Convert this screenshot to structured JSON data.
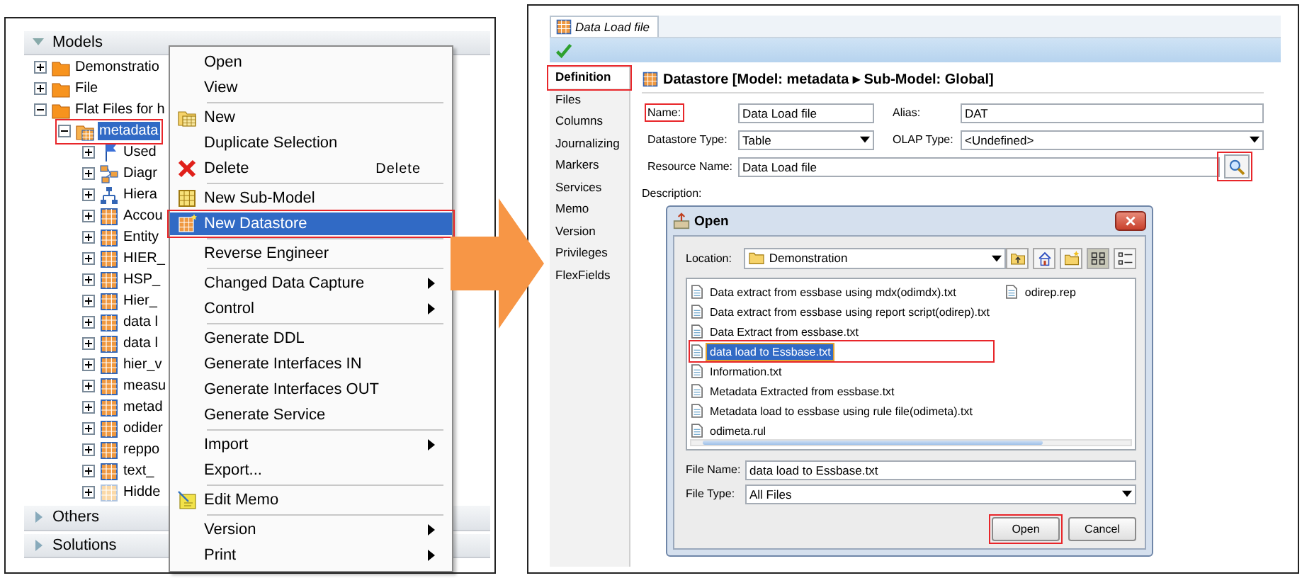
{
  "left_window": {
    "models_header": {
      "label": "Models",
      "expanded": true
    },
    "tree": [
      {
        "label": "Demonstratio",
        "kind": "folder",
        "expanded": false,
        "selected": false
      },
      {
        "label": "File",
        "kind": "folder",
        "expanded": false,
        "selected": false
      },
      {
        "label": "Flat Files for h",
        "kind": "folder",
        "expanded": true,
        "selected": false,
        "children": [
          {
            "label": "metadata",
            "kind": "model",
            "expanded": true,
            "selected": true,
            "highlighted": true,
            "children": [
              {
                "label": "Used",
                "kind": "flag",
                "expanded": false,
                "selected": false
              },
              {
                "label": "Diagr",
                "kind": "diagram",
                "expanded": false,
                "selected": false
              },
              {
                "label": "Hiera",
                "kind": "hierarchy",
                "expanded": false,
                "selected": false
              },
              {
                "label": "Accou",
                "kind": "datastore",
                "expanded": false,
                "selected": false
              },
              {
                "label": "Entity",
                "kind": "datastore",
                "expanded": false,
                "selected": false
              },
              {
                "label": "HIER_",
                "kind": "datastore",
                "expanded": false,
                "selected": false
              },
              {
                "label": "HSP_",
                "kind": "datastore",
                "expanded": false,
                "selected": false
              },
              {
                "label": "Hier_",
                "kind": "datastore",
                "expanded": false,
                "selected": false
              },
              {
                "label": "data l",
                "kind": "datastore",
                "expanded": false,
                "selected": false
              },
              {
                "label": "data l",
                "kind": "datastore",
                "expanded": false,
                "selected": false
              },
              {
                "label": "hier_v",
                "kind": "datastore",
                "expanded": false,
                "selected": false
              },
              {
                "label": "measu",
                "kind": "datastore",
                "expanded": false,
                "selected": false
              },
              {
                "label": "metad",
                "kind": "datastore",
                "expanded": false,
                "selected": false
              },
              {
                "label": "odider",
                "kind": "datastore",
                "expanded": false,
                "selected": false
              },
              {
                "label": "reppo",
                "kind": "datastore",
                "expanded": false,
                "selected": false
              },
              {
                "label": "text_",
                "kind": "datastore",
                "expanded": false,
                "selected": false
              },
              {
                "label": "Hidde",
                "kind": "pale-datastore",
                "expanded": false,
                "selected": false
              }
            ]
          }
        ]
      }
    ],
    "sections": [
      {
        "label": "Others",
        "expanded": false
      },
      {
        "label": "Solutions",
        "expanded": false
      }
    ]
  },
  "context_menu": {
    "groups": [
      [
        {
          "label": "Open",
          "submenu": false,
          "selected": false
        },
        {
          "label": "View",
          "submenu": false,
          "selected": false
        }
      ],
      [
        {
          "label": "New",
          "kind": "new",
          "submenu": false,
          "selected": false
        },
        {
          "label": "Duplicate Selection",
          "submenu": false,
          "selected": false
        },
        {
          "label": "Delete",
          "kind": "delete",
          "shortcut": "Delete",
          "submenu": false,
          "selected": false
        }
      ],
      [
        {
          "label": "New Sub-Model",
          "kind": "submodel",
          "submenu": false,
          "selected": false
        },
        {
          "label": "New Datastore",
          "kind": "datastore",
          "submenu": false,
          "selected": true,
          "highlighted": true
        }
      ],
      [
        {
          "label": "Reverse Engineer",
          "submenu": false,
          "selected": false
        }
      ],
      [
        {
          "label": "Changed Data Capture",
          "submenu": true,
          "selected": false
        },
        {
          "label": "Control",
          "submenu": true,
          "selected": false
        }
      ],
      [
        {
          "label": "Generate DDL",
          "submenu": false,
          "selected": false
        },
        {
          "label": "Generate Interfaces IN",
          "submenu": false,
          "selected": false
        },
        {
          "label": "Generate Interfaces OUT",
          "submenu": false,
          "selected": false
        },
        {
          "label": "Generate Service",
          "submenu": false,
          "selected": false
        }
      ],
      [
        {
          "label": "Import",
          "submenu": true,
          "selected": false
        },
        {
          "label": "Export...",
          "submenu": false,
          "selected": false
        }
      ],
      [
        {
          "label": "Edit Memo",
          "kind": "memo",
          "submenu": false,
          "selected": false
        }
      ],
      [
        {
          "label": "Version",
          "submenu": true,
          "selected": false
        },
        {
          "label": "Print",
          "submenu": true,
          "selected": false
        }
      ]
    ]
  },
  "right_window": {
    "tab": {
      "label": "Data Load file"
    },
    "nav": [
      {
        "label": "Definition",
        "selected": true,
        "highlighted": true
      },
      {
        "label": "Files",
        "selected": false
      },
      {
        "label": "Columns",
        "selected": false
      },
      {
        "label": "Journalizing",
        "selected": false
      },
      {
        "label": "Markers",
        "selected": false
      },
      {
        "label": "Services",
        "selected": false
      },
      {
        "label": "Memo",
        "selected": false
      },
      {
        "label": "Version",
        "selected": false
      },
      {
        "label": "Privileges",
        "selected": false
      },
      {
        "label": "FlexFields",
        "selected": false
      }
    ],
    "form": {
      "title": "Datastore [Model: metadata ▸ Sub-Model: Global]",
      "name": {
        "label": "Name:",
        "value": "Data Load file",
        "highlighted": true
      },
      "alias": {
        "label": "Alias:",
        "value": "DAT"
      },
      "datastore_type": {
        "label": "Datastore Type:",
        "value": "Table"
      },
      "olap_type": {
        "label": "OLAP Type:",
        "value": "<Undefined>"
      },
      "resource_name": {
        "label": "Resource Name:",
        "value": "Data Load file",
        "search_highlighted": true
      },
      "description": {
        "label": "Description:"
      }
    },
    "open_dialog": {
      "title": "Open",
      "location": {
        "label": "Location:",
        "value": "Demonstration"
      },
      "toolbar": [
        {
          "kind": "up-folder",
          "selected": false
        },
        {
          "kind": "home",
          "selected": false
        },
        {
          "kind": "new-folder",
          "selected": false
        },
        {
          "kind": "list-view",
          "selected": true
        },
        {
          "kind": "details-view",
          "selected": false
        }
      ],
      "file_columns": [
        [
          {
            "label": "Data extract from essbase using mdx(odimdx).txt",
            "selected": false
          },
          {
            "label": "Data extract from essbase using report script(odirep).txt",
            "selected": false
          },
          {
            "label": "Data Extract from essbase.txt",
            "selected": false
          },
          {
            "label": "data load to Essbase.txt",
            "selected": true,
            "highlighted": true
          },
          {
            "label": "Information.txt",
            "selected": false
          },
          {
            "label": "Metadata Extracted from essbase.txt",
            "selected": false
          },
          {
            "label": "Metadata load to essbase using rule file(odimeta).txt",
            "selected": false
          },
          {
            "label": "odimeta.rul",
            "selected": false
          }
        ],
        [
          {
            "label": "odirep.rep",
            "selected": false
          }
        ]
      ],
      "file_name": {
        "label": "File Name:",
        "value": "data load to Essbase.txt"
      },
      "file_type": {
        "label": "File Type:",
        "value": "All Files"
      },
      "buttons": [
        {
          "label": "Open",
          "highlighted": true
        },
        {
          "label": "Cancel"
        }
      ]
    }
  }
}
